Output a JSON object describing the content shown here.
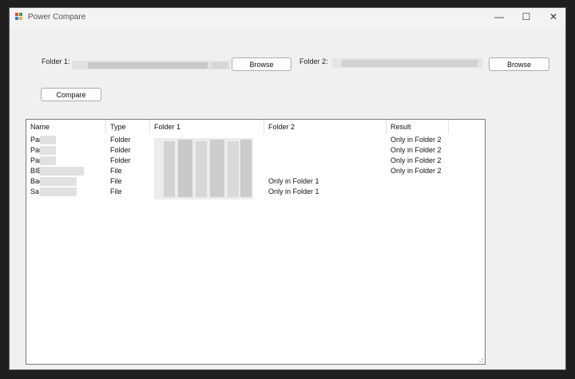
{
  "window": {
    "title": "Power Compare",
    "minimize_glyph": "—",
    "maximize_glyph": "☐",
    "close_glyph": "✕",
    "app_icon": "windows-app-icon"
  },
  "folder1": {
    "label": "Folder 1:",
    "browse_label": "Browse",
    "value": ""
  },
  "folder2": {
    "label": "Folder 2:",
    "browse_label": "Browse",
    "value": ""
  },
  "compare_label": "Compare",
  "table": {
    "columns": [
      "Name",
      "Type",
      "Folder 1",
      "Folder 2",
      "Result"
    ],
    "rows": [
      {
        "name": "Par",
        "type": "Folder",
        "folder1": "",
        "folder2": "",
        "result": "Only in Folder 2"
      },
      {
        "name": "Par",
        "type": "Folder",
        "folder1": "",
        "folder2": "",
        "result": "Only in Folder 2"
      },
      {
        "name": "Par",
        "type": "Folder",
        "folder1": "",
        "folder2": "",
        "result": "Only in Folder 2"
      },
      {
        "name": "BIE",
        "type": "File",
        "folder1": "",
        "folder2": "",
        "result": "Only in Folder 2"
      },
      {
        "name": "Bac",
        "type": "File",
        "folder1": "",
        "folder2": "Only in Folder 1",
        "result": ""
      },
      {
        "name": "Sa",
        "type": "File",
        "folder1": "",
        "folder2": "Only in Folder 1",
        "result": ""
      }
    ]
  },
  "colors": {
    "window_bg": "#f0f0f0",
    "list_bg": "#ffffff",
    "border": "#7a7a7a",
    "redacted": "#cfcfcf"
  }
}
